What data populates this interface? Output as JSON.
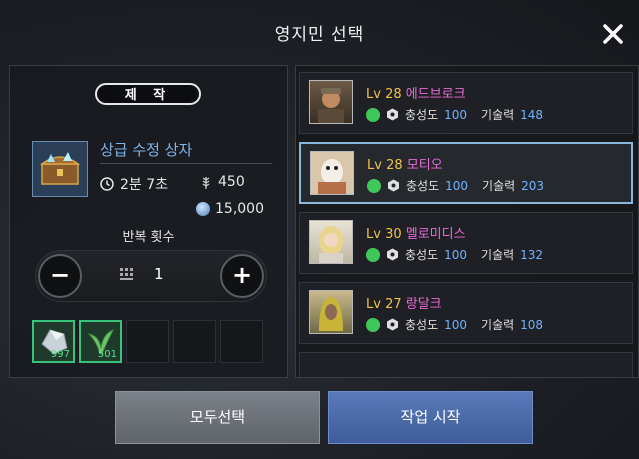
{
  "dialog": {
    "title": "영지민 선택"
  },
  "craft": {
    "badge": "제 작",
    "item_name": "상급 수정 상자",
    "time": "2분 7초",
    "energy": "450",
    "cost": "15,000",
    "repeat_label": "반복 횟수",
    "repeat_count": "1",
    "materials": [
      {
        "icon": "ore-icon",
        "qty": "997"
      },
      {
        "icon": "herb-icon",
        "qty": "501"
      }
    ]
  },
  "workers": [
    {
      "lv": "Lv 28",
      "name": "에드브로크",
      "loyalty_label": "충성도",
      "loyalty": "100",
      "skill_label": "기술력",
      "skill": "148"
    },
    {
      "lv": "Lv 28",
      "name": "모티오",
      "loyalty_label": "충성도",
      "loyalty": "100",
      "skill_label": "기술력",
      "skill": "203"
    },
    {
      "lv": "Lv 30",
      "name": "멜로미디스",
      "loyalty_label": "충성도",
      "loyalty": "100",
      "skill_label": "기술력",
      "skill": "132"
    },
    {
      "lv": "Lv 27",
      "name": "랑달크",
      "loyalty_label": "충성도",
      "loyalty": "100",
      "skill_label": "기술력",
      "skill": "108"
    }
  ],
  "buttons": {
    "select_all": "모두선택",
    "start": "작업 시작"
  },
  "colors": {
    "accent_blue": "#4a6aa8",
    "level_gold": "#f1c24b",
    "name_pink": "#e86bd6",
    "stat_blue": "#6fb3ff",
    "material_green": "#37c47a"
  }
}
